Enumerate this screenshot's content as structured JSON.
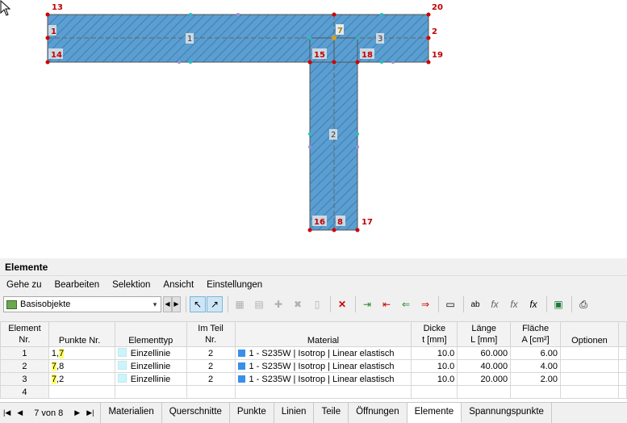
{
  "canvas": {
    "point_labels": [
      "13",
      "20",
      "1",
      "2",
      "14",
      "19",
      "15",
      "18",
      "16",
      "8",
      "17",
      "7"
    ],
    "member_labels": [
      "1",
      "2",
      "3",
      "7"
    ],
    "hatch_color": "#5b9ed1",
    "outline_color": "#555555"
  },
  "panel": {
    "title": "Elemente",
    "menu": [
      "Gehe zu",
      "Bearbeiten",
      "Selektion",
      "Ansicht",
      "Einstellungen"
    ],
    "combo_value": "Basisobjekte",
    "columns": [
      {
        "l1": "Element",
        "l2": "Nr."
      },
      {
        "l1": "",
        "l2": "Punkte Nr."
      },
      {
        "l1": "",
        "l2": "Elementtyp"
      },
      {
        "l1": "Im Teil",
        "l2": "Nr."
      },
      {
        "l1": "",
        "l2": "Material"
      },
      {
        "l1": "Dicke",
        "l2": "t [mm]"
      },
      {
        "l1": "Länge",
        "l2": "L [mm]"
      },
      {
        "l1": "Fläche",
        "l2": "A [cm²]"
      },
      {
        "l1": "",
        "l2": "Optionen"
      }
    ],
    "rows": [
      {
        "nr": "1",
        "pts_a": "1,",
        "pts_b": "7",
        "pts_hl": "b",
        "type": "Einzellinie",
        "teil": "2",
        "material": "1 - S235W | Isotrop | Linear elastisch",
        "t": "10.0",
        "l": "60.000",
        "a": "6.00"
      },
      {
        "nr": "2",
        "pts_a": "7",
        "pts_b": ",8",
        "pts_hl": "a",
        "type": "Einzellinie",
        "teil": "2",
        "material": "1 - S235W | Isotrop | Linear elastisch",
        "t": "10.0",
        "l": "40.000",
        "a": "4.00"
      },
      {
        "nr": "3",
        "pts_a": "7",
        "pts_b": ",2",
        "pts_hl": "a",
        "type": "Einzellinie",
        "teil": "2",
        "material": "1 - S235W | Isotrop | Linear elastisch",
        "t": "10.0",
        "l": "20.000",
        "a": "2.00"
      },
      {
        "nr": "4",
        "pts_a": "",
        "pts_b": "",
        "pts_hl": "",
        "type": "",
        "teil": "",
        "material": "",
        "t": "",
        "l": "",
        "a": ""
      }
    ],
    "pager": "7 von 8",
    "tabs": [
      "Materialien",
      "Querschnitte",
      "Punkte",
      "Linien",
      "Teile",
      "Öffnungen",
      "Elemente",
      "Spannungspunkte"
    ],
    "active_tab": "Elemente"
  }
}
